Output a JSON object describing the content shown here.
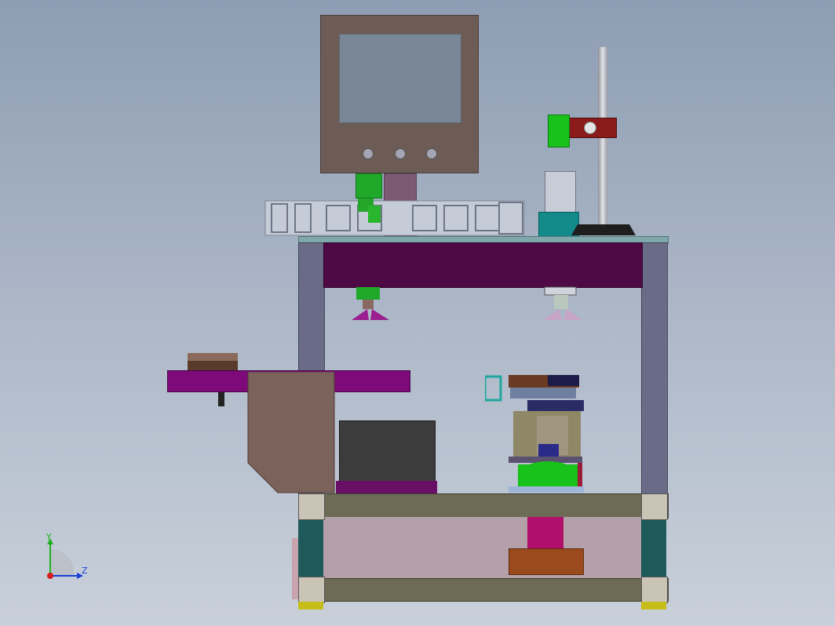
{
  "viewport": {
    "background_top": "#8e9db3",
    "background_bottom": "#c9d0da"
  },
  "triad": {
    "y_label": "Y",
    "z_label": "Z",
    "y_color": "#1fb01f",
    "z_color": "#1a3fd9",
    "x_color": "#d61b1b"
  },
  "colors": {
    "frame_post": "#6a6b86",
    "top_beam": "#4f0a46",
    "table_top": "#7fa8ad",
    "hmi_housing": "#6d5c55",
    "hmi_screen": "#7a8796",
    "conveyor_arm": "#7e0a7a",
    "bin_body": "#7b625a",
    "tray_box": "#3c3c3c",
    "tray_base": "#6a0f66",
    "lower_rail": "#6d6a55",
    "lower_panel": "#b4a0a8",
    "green_part": "#19c21b",
    "teal_part": "#138a8a",
    "stand_pole": "#bdbdc4",
    "red_clamp": "#8b1a1a",
    "motor_block": "#9a4a1c",
    "foot": "#c7bd1a"
  },
  "icons": [
    "hmi-button-icon",
    "coordinate-triad-icon"
  ]
}
